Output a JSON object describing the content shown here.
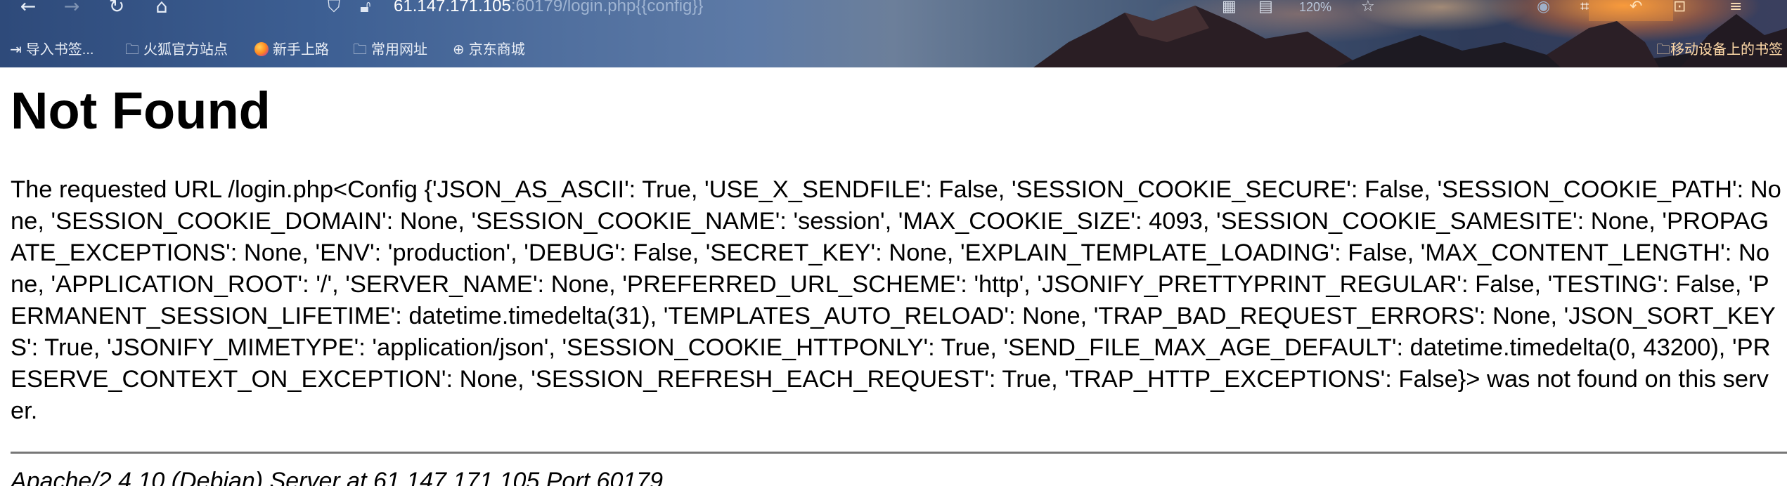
{
  "browser": {
    "url_host": "61.147.171.105",
    "url_rest": ":60179/login.php{{config}}",
    "zoom": "120%",
    "bookmarks": [
      {
        "label": "导入书签...",
        "icon": "import-icon"
      },
      {
        "label": "火狐官方站点",
        "icon": "folder-icon"
      },
      {
        "label": "新手上路",
        "icon": "firefox-icon"
      },
      {
        "label": "常用网址",
        "icon": "folder-icon"
      },
      {
        "label": "京东商城",
        "icon": "globe-icon"
      }
    ],
    "mobile_bookmarks": "移动设备上的书签"
  },
  "page": {
    "title": "Not Found",
    "message": "The requested URL /login.php<Config {'JSON_AS_ASCII': True, 'USE_X_SENDFILE': False, 'SESSION_COOKIE_SECURE': False, 'SESSION_COOKIE_PATH': None, 'SESSION_COOKIE_DOMAIN': None, 'SESSION_COOKIE_NAME': 'session', 'MAX_COOKIE_SIZE': 4093, 'SESSION_COOKIE_SAMESITE': None, 'PROPAGATE_EXCEPTIONS': None, 'ENV': 'production', 'DEBUG': False, 'SECRET_KEY': None, 'EXPLAIN_TEMPLATE_LOADING': False, 'MAX_CONTENT_LENGTH': None, 'APPLICATION_ROOT': '/', 'SERVER_NAME': None, 'PREFERRED_URL_SCHEME': 'http', 'JSONIFY_PRETTYPRINT_REGULAR': False, 'TESTING': False, 'PERMANENT_SESSION_LIFETIME': datetime.timedelta(31), 'TEMPLATES_AUTO_RELOAD': None, 'TRAP_BAD_REQUEST_ERRORS': None, 'JSON_SORT_KEYS': True, 'JSONIFY_MIMETYPE': 'application/json', 'SESSION_COOKIE_HTTPONLY': True, 'SEND_FILE_MAX_AGE_DEFAULT': datetime.timedelta(0, 43200), 'PRESERVE_CONTEXT_ON_EXCEPTION': None, 'SESSION_REFRESH_EACH_REQUEST': True, 'TRAP_HTTP_EXCEPTIONS': False}> was not found on this server.",
    "server_signature": "Apache/2.4.10 (Debian) Server at 61.147.171.105 Port 60179"
  }
}
